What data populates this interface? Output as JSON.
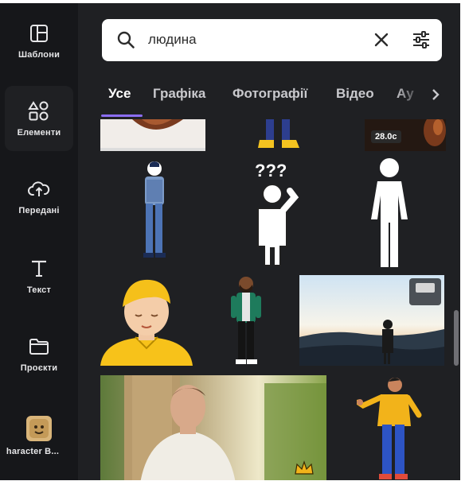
{
  "rail": {
    "items": [
      {
        "label": "Шаблони",
        "icon": "layout-icon"
      },
      {
        "label": "Елементи",
        "icon": "shapes-icon",
        "active": true
      },
      {
        "label": "Передані",
        "icon": "cloud-upload-icon"
      },
      {
        "label": "Текст",
        "icon": "text-icon"
      },
      {
        "label": "Проєкти",
        "icon": "folder-icon"
      },
      {
        "label": "haracter B...",
        "icon": "character-builder-icon"
      }
    ]
  },
  "search": {
    "query": "людина",
    "icon": "search-icon"
  },
  "tabs": [
    {
      "label": "Усе",
      "active": true
    },
    {
      "label": "Графіка"
    },
    {
      "label": "Фотографії"
    },
    {
      "label": "Відео"
    },
    {
      "label": "Ау"
    }
  ],
  "results": {
    "video_duration": "28.0с",
    "tiles": [
      {
        "kind": "photo-fragment",
        "icon": "photo-thumbnail"
      },
      {
        "kind": "graphic",
        "icon": "legs-illustration"
      },
      {
        "kind": "video",
        "icon": "video-thumbnail"
      },
      {
        "kind": "graphic",
        "icon": "man-standing-illustration"
      },
      {
        "kind": "graphic",
        "icon": "confused-person-icon"
      },
      {
        "kind": "graphic",
        "icon": "person-silhouette-icon"
      },
      {
        "kind": "graphic",
        "icon": "blond-man-illustration"
      },
      {
        "kind": "graphic",
        "icon": "bearded-man-illustration"
      },
      {
        "kind": "photo",
        "icon": "landscape-photo"
      },
      {
        "kind": "photo",
        "icon": "man-portrait-photo",
        "badge": "crown-icon"
      },
      {
        "kind": "graphic",
        "icon": "presenting-man-illustration"
      }
    ]
  },
  "colors": {
    "panel": "#1f2023",
    "rail": "#16171a",
    "accent": "#8b6df3",
    "tile_yellow": "#f7c21a"
  }
}
